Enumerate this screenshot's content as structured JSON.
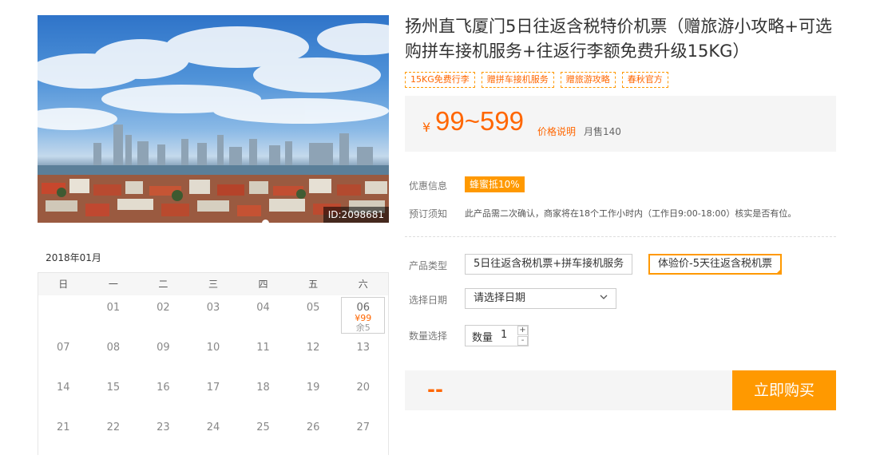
{
  "product": {
    "title": "扬州直飞厦门5日往返含税特价机票（赠旅游小攻略+可选购拼车接机服务+往返行李额免费升级15KG）",
    "tags": [
      "15KG免费行李",
      "赠拼车接机服务",
      "赠旅游攻略",
      "春秋官方"
    ],
    "image_id": "ID:2098681"
  },
  "price": {
    "currency": "¥",
    "range": "99~599",
    "explain_link": "价格说明",
    "monthly_sales": "月售140"
  },
  "info": {
    "discount_label": "优惠信息",
    "discount_badge": "蜂蜜抵10%",
    "notice_label": "预订须知",
    "notice_text": "此产品需二次确认，商家将在18个工作小时内（工作日9:00-18:00）核实是否有位。"
  },
  "options": {
    "type_label": "产品类型",
    "types": [
      "5日往返含税机票+拼车接机服务",
      "体验价-5天往返含税机票"
    ],
    "selected_type_index": 1,
    "date_label": "选择日期",
    "date_placeholder": "请选择日期",
    "qty_label": "数量选择",
    "qty_inner_label": "数量",
    "qty_value": "1",
    "plus": "+",
    "minus": "-"
  },
  "purchase": {
    "total": "--",
    "buy_label": "立即购买"
  },
  "calendar": {
    "month": "2018年01月",
    "weekdays": [
      "日",
      "一",
      "二",
      "三",
      "四",
      "五",
      "六"
    ],
    "days": [
      {
        "day": ""
      },
      {
        "day": "01"
      },
      {
        "day": "02"
      },
      {
        "day": "03"
      },
      {
        "day": "04"
      },
      {
        "day": "05"
      },
      {
        "day": "06",
        "price": "¥99",
        "stock": "余5"
      },
      {
        "day": "07"
      },
      {
        "day": "08"
      },
      {
        "day": "09"
      },
      {
        "day": "10"
      },
      {
        "day": "11"
      },
      {
        "day": "12"
      },
      {
        "day": "13"
      },
      {
        "day": "14"
      },
      {
        "day": "15"
      },
      {
        "day": "16"
      },
      {
        "day": "17"
      },
      {
        "day": "18"
      },
      {
        "day": "19"
      },
      {
        "day": "20"
      },
      {
        "day": "21"
      },
      {
        "day": "22"
      },
      {
        "day": "23"
      },
      {
        "day": "24"
      },
      {
        "day": "25"
      },
      {
        "day": "26"
      },
      {
        "day": "27"
      }
    ]
  },
  "colors": {
    "accent": "#ff9900",
    "price": "#ff6600"
  }
}
